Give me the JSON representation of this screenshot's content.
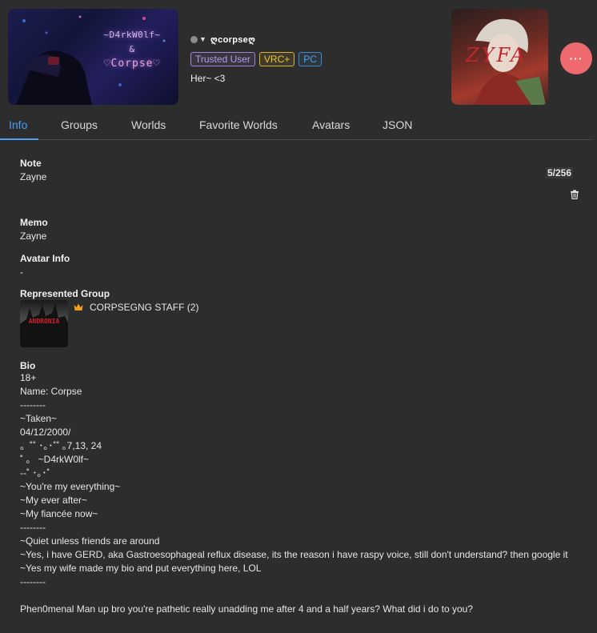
{
  "user": {
    "display_name": "ღcorpseღ",
    "status_text": "Her~ <3",
    "badges": [
      "Trusted User",
      "VRC+",
      "PC"
    ]
  },
  "banner": {
    "line1": "~D4rkW0lf~",
    "line2": "&",
    "line3": "♡Corpse♡"
  },
  "avatar_thumb": {
    "text": "ZYFA"
  },
  "more_button": {
    "label": "···"
  },
  "tabs": [
    "Info",
    "Groups",
    "Worlds",
    "Favorite Worlds",
    "Avatars",
    "JSON"
  ],
  "active_tab": "Info",
  "info": {
    "note_label": "Note",
    "note_value": "Zayne",
    "note_count": "5/256",
    "memo_label": "Memo",
    "memo_value": "Zayne",
    "avatar_info_label": "Avatar Info",
    "avatar_info_value": "-",
    "group_label": "Represented Group",
    "group_name": "CORPSEGNG STAFF",
    "group_count": "(2)",
    "group_thumb_text": "ANDRONIA",
    "bio_label": "Bio",
    "bio_lines": [
      "18+",
      "Name: Corpse",
      "--------",
      "~Taken~",
      "04/12/2000/",
      "。˚˚ ･｡･˚˚ ｡7,13, 24",
      "˚ 。 ~D4rkW0lf~",
      "--˚ ･｡･˚",
      "~You're my everything~",
      "~My ever after~",
      "~My fiancée now~",
      "--------",
      "~Quiet unless friends are around",
      "~Yes, i have GERD, aka Gastroesophageal reflux disease, its the reason i have raspy voice, still don't understand? then google it",
      "~Yes my wife made my bio and put everything here, LOL",
      "--------",
      "",
      "Phen0menal Man up bro you're pathetic really unadding me after 4 and a half years? What did i do to you?"
    ]
  },
  "colors": {
    "background": "#2d2d2d",
    "accent": "#4b9ff3",
    "trusted": "#a084dd",
    "vrc_plus": "#dcb12a",
    "pc": "#3f88d0",
    "more_button": "#ef6a6e"
  },
  "icons": [
    "status-dot-icon",
    "chevron-down-icon",
    "more-dots-icon",
    "trash-icon",
    "crown-icon"
  ]
}
